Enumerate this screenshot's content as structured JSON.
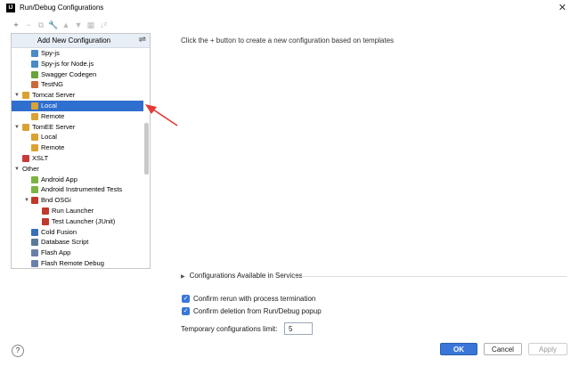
{
  "window": {
    "title": "Run/Debug Configurations",
    "icon_text": "IJ"
  },
  "toolbar": {
    "icons": [
      "plus-icon",
      "minus-icon",
      "copy-icon",
      "wrench-icon",
      "arrow-up-icon",
      "arrow-down-icon",
      "folder-icon",
      "sort-icon"
    ]
  },
  "left_panel": {
    "header": "Add New Configuration",
    "items": [
      {
        "label": "Spy-js",
        "icon": "spy-icon",
        "color": "#4a8ac7"
      },
      {
        "label": "Spy-js for Node.js",
        "icon": "spy-icon",
        "color": "#4a8ac7"
      },
      {
        "label": "Swagger Codegen",
        "icon": "swagger-icon",
        "color": "#6aa33a"
      },
      {
        "label": "TestNG",
        "icon": "testng-icon",
        "color": "#c86a3a"
      },
      {
        "label": "Tomcat Server",
        "icon": "tomcat-icon",
        "color": "#d9a233",
        "expanded": true
      },
      {
        "label": "Local",
        "icon": "tomcat-icon",
        "color": "#d9a233",
        "selected": true
      },
      {
        "label": "Remote",
        "icon": "tomcat-icon",
        "color": "#d9a233"
      },
      {
        "label": "TomEE Server",
        "icon": "tomee-icon",
        "color": "#d9a233",
        "expanded": true
      },
      {
        "label": "Local",
        "icon": "tomee-icon",
        "color": "#d9a233"
      },
      {
        "label": "Remote",
        "icon": "tomee-icon",
        "color": "#d9a233"
      },
      {
        "label": "XSLT",
        "icon": "xslt-icon",
        "color": "#c83b3b"
      },
      {
        "label": "Other",
        "icon": "",
        "color": "",
        "expanded": true
      },
      {
        "label": "Android App",
        "icon": "android-icon",
        "color": "#7cb342"
      },
      {
        "label": "Android Instrumented Tests",
        "icon": "android-icon",
        "color": "#7cb342"
      },
      {
        "label": "Bnd OSGi",
        "icon": "bnd-icon",
        "color": "#c0392b",
        "expanded": true
      },
      {
        "label": "Run Launcher",
        "icon": "bnd-icon",
        "color": "#c0392b"
      },
      {
        "label": "Test Launcher (JUnit)",
        "icon": "bnd-icon",
        "color": "#c0392b"
      },
      {
        "label": "Cold Fusion",
        "icon": "coldfusion-icon",
        "color": "#3a6fb8"
      },
      {
        "label": "Database Script",
        "icon": "database-icon",
        "color": "#5a7a9a"
      },
      {
        "label": "Flash App",
        "icon": "flash-icon",
        "color": "#6a7fa8"
      },
      {
        "label": "Flash Remote Debug",
        "icon": "flash-icon",
        "color": "#6a7fa8"
      }
    ]
  },
  "right_panel": {
    "hint": "Click the + button to create a new configuration based on templates",
    "services_label": "Configurations Available in Services",
    "checkbox_rerun": "Confirm rerun with process termination",
    "checkbox_delete": "Confirm deletion from Run/Debug popup",
    "limit_label": "Temporary configurations limit:",
    "limit_value": "5"
  },
  "footer": {
    "help": "?",
    "ok": "OK",
    "cancel": "Cancel",
    "apply": "Apply"
  },
  "colors": {
    "accent": "#3a76d8",
    "selection": "#2f6fcf",
    "annotation": "#e53935"
  }
}
